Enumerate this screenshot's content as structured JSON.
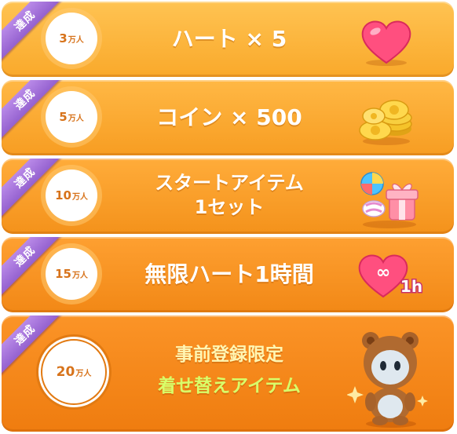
{
  "rewards": [
    {
      "status": "達成",
      "milestone_number": "3",
      "milestone_unit": "万人",
      "reward_line1": "ハート × 5",
      "icon": "heart-icon"
    },
    {
      "status": "達成",
      "milestone_number": "5",
      "milestone_unit": "万人",
      "reward_line1": "コイン × 500",
      "icon": "coins-icon"
    },
    {
      "status": "達成",
      "milestone_number": "10",
      "milestone_unit": "万人",
      "reward_line1": "スタートアイテム",
      "reward_line2": "1セット",
      "icon": "start-items-icon"
    },
    {
      "status": "達成",
      "milestone_number": "15",
      "milestone_unit": "万人",
      "reward_line1": "無限ハート1時間",
      "icon": "infinite-heart-1h-icon",
      "icon_text": "1h",
      "icon_symbol": "∞"
    },
    {
      "status": "達成",
      "milestone_number": "20",
      "milestone_unit": "万人",
      "reward_line1": "事前登録限定",
      "reward_line2": "着せ替えアイテム",
      "icon": "bear-costume-icon"
    }
  ],
  "colors": {
    "ribbon": "#9c6bd6",
    "badge_text": "#d7731b",
    "heart": "#ff4f7f",
    "coin": "#f5c32a",
    "final_line1": "#fff6b3",
    "final_line2": "#d8ff6a"
  }
}
